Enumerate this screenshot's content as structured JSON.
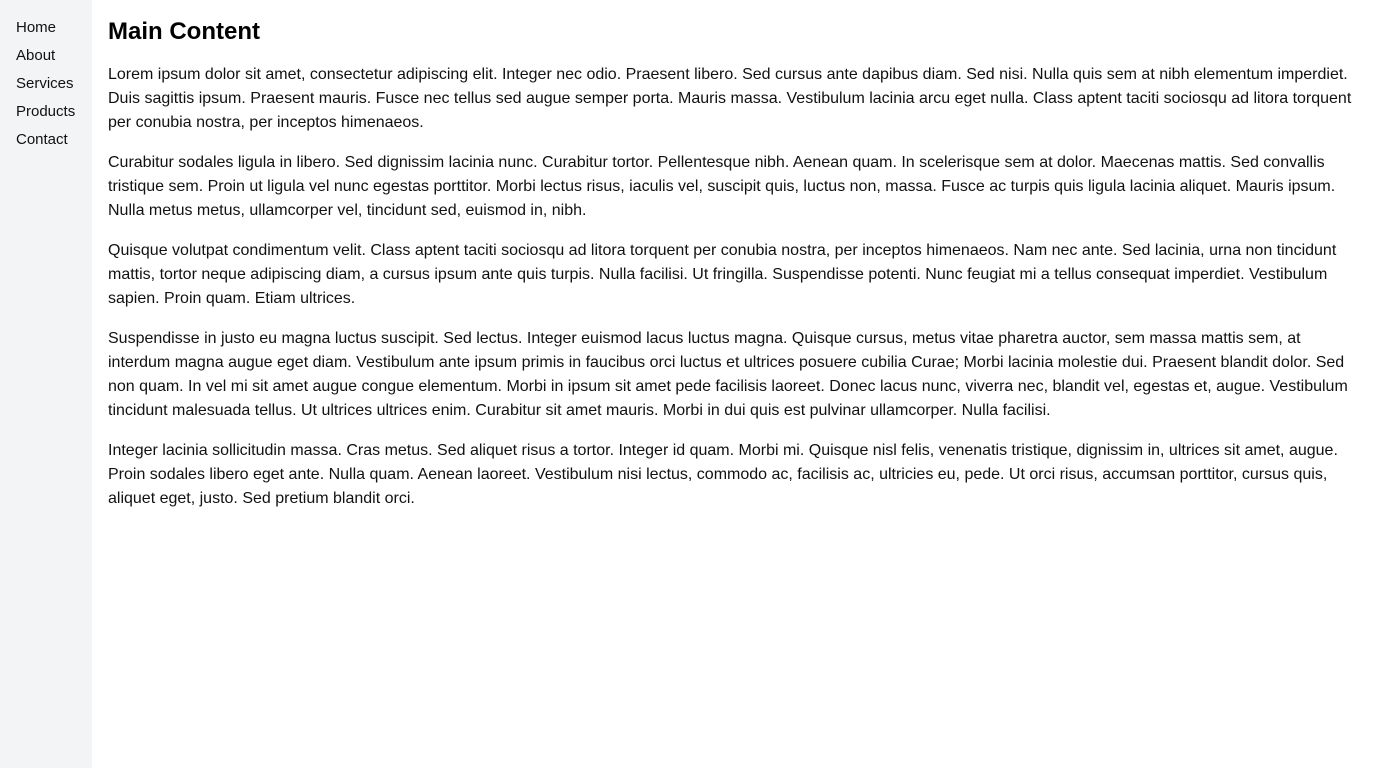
{
  "sidebar": {
    "items": [
      {
        "label": "Home"
      },
      {
        "label": "About"
      },
      {
        "label": "Services"
      },
      {
        "label": "Products"
      },
      {
        "label": "Contact"
      }
    ]
  },
  "main": {
    "title": "Main Content",
    "paragraphs": [
      "Lorem ipsum dolor sit amet, consectetur adipiscing elit. Integer nec odio. Praesent libero. Sed cursus ante dapibus diam. Sed nisi. Nulla quis sem at nibh elementum imperdiet. Duis sagittis ipsum. Praesent mauris. Fusce nec tellus sed augue semper porta. Mauris massa. Vestibulum lacinia arcu eget nulla. Class aptent taciti sociosqu ad litora torquent per conubia nostra, per inceptos himenaeos.",
      "Curabitur sodales ligula in libero. Sed dignissim lacinia nunc. Curabitur tortor. Pellentesque nibh. Aenean quam. In scelerisque sem at dolor. Maecenas mattis. Sed convallis tristique sem. Proin ut ligula vel nunc egestas porttitor. Morbi lectus risus, iaculis vel, suscipit quis, luctus non, massa. Fusce ac turpis quis ligula lacinia aliquet. Mauris ipsum. Nulla metus metus, ullamcorper vel, tincidunt sed, euismod in, nibh.",
      "Quisque volutpat condimentum velit. Class aptent taciti sociosqu ad litora torquent per conubia nostra, per inceptos himenaeos. Nam nec ante. Sed lacinia, urna non tincidunt mattis, tortor neque adipiscing diam, a cursus ipsum ante quis turpis. Nulla facilisi. Ut fringilla. Suspendisse potenti. Nunc feugiat mi a tellus consequat imperdiet. Vestibulum sapien. Proin quam. Etiam ultrices.",
      "Suspendisse in justo eu magna luctus suscipit. Sed lectus. Integer euismod lacus luctus magna. Quisque cursus, metus vitae pharetra auctor, sem massa mattis sem, at interdum magna augue eget diam. Vestibulum ante ipsum primis in faucibus orci luctus et ultrices posuere cubilia Curae; Morbi lacinia molestie dui. Praesent blandit dolor. Sed non quam. In vel mi sit amet augue congue elementum. Morbi in ipsum sit amet pede facilisis laoreet. Donec lacus nunc, viverra nec, blandit vel, egestas et, augue. Vestibulum tincidunt malesuada tellus. Ut ultrices ultrices enim. Curabitur sit amet mauris. Morbi in dui quis est pulvinar ullamcorper. Nulla facilisi.",
      "Integer lacinia sollicitudin massa. Cras metus. Sed aliquet risus a tortor. Integer id quam. Morbi mi. Quisque nisl felis, venenatis tristique, dignissim in, ultrices sit amet, augue. Proin sodales libero eget ante. Nulla quam. Aenean laoreet. Vestibulum nisi lectus, commodo ac, facilisis ac, ultricies eu, pede. Ut orci risus, accumsan porttitor, cursus quis, aliquet eget, justo. Sed pretium blandit orci."
    ]
  },
  "colors": {
    "sidebar_bg": "#f3f4f6",
    "page_bg": "#ffffff",
    "text": "#111111"
  }
}
